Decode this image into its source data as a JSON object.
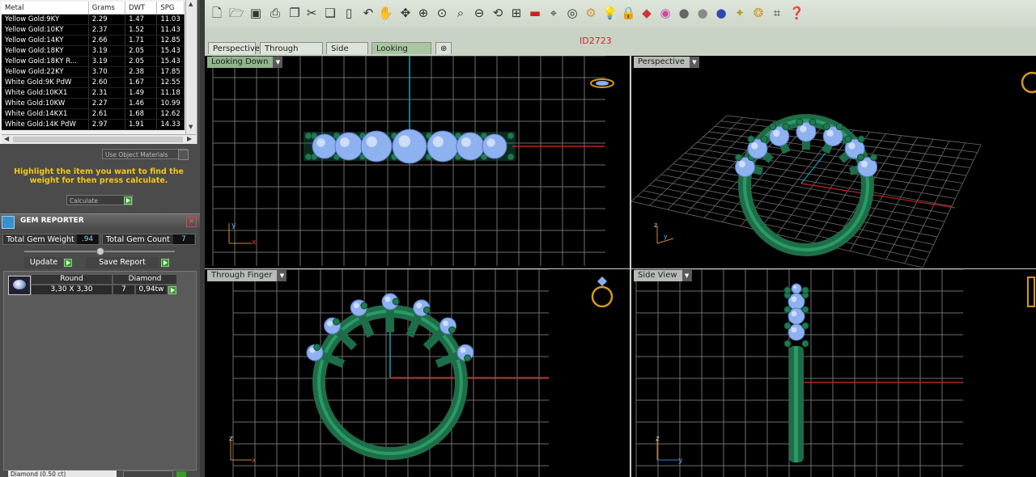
{
  "metal_table": {
    "headers": [
      "Metal",
      "Grams",
      "DWT",
      "SPG"
    ],
    "rows": [
      [
        "Yellow Gold:9KY",
        "2.29",
        "1.47",
        "11.03"
      ],
      [
        "Yellow Gold:10KY",
        "2.37",
        "1.52",
        "11.43"
      ],
      [
        "Yellow Gold:14KY",
        "2.66",
        "1.71",
        "12.85"
      ],
      [
        "Yellow Gold:18KY",
        "3.19",
        "2.05",
        "15.43"
      ],
      [
        "Yellow Gold:18KY R...",
        "3.19",
        "2.05",
        "15.43"
      ],
      [
        "Yellow Gold:22KY",
        "3.70",
        "2.38",
        "17.85"
      ],
      [
        "White Gold:9K PdW",
        "2.60",
        "1.67",
        "12.55"
      ],
      [
        "White Gold:10KX1",
        "2.31",
        "1.49",
        "11.18"
      ],
      [
        "White Gold:10KW",
        "2.27",
        "1.46",
        "10.99"
      ],
      [
        "White Gold:14KX1",
        "2.61",
        "1.68",
        "12.62"
      ],
      [
        "White Gold:14K PdW",
        "2.97",
        "1.91",
        "14.33"
      ]
    ]
  },
  "use_object_materials": "Use Object Materials",
  "instruction": "Highlight the item you want to find the weight for then press calculate.",
  "calculate_label": "Calculate",
  "gem_reporter": {
    "title": "GEM REPORTER",
    "total_weight_label": "Total Gem Weight",
    "total_weight_value": ".94",
    "total_count_label": "Total Gem Count",
    "total_count_value": "7",
    "update_label": "Update",
    "save_report_label": "Save Report",
    "gem_row": {
      "shape_header": "Round",
      "type_header": "Diamond",
      "size": "3,30 X 3,30",
      "count": "7",
      "weight": "0,94tw"
    }
  },
  "bottom_select": "Diamond (0.50 ct)",
  "id_label": "ID2723",
  "tabs": [
    "Perspective",
    "Through Finger",
    "Side View",
    "Looking Down"
  ],
  "active_tab": "Looking Down",
  "viewports": {
    "top_left": "Looking Down",
    "top_right": "Perspective",
    "bottom_left": "Through Finger",
    "bottom_right": "Side View"
  },
  "axis_labels": {
    "x": "x",
    "y": "y",
    "z": "z"
  },
  "colors": {
    "ring_green": "#1f7a52",
    "gem_blue": "#8eb1f0",
    "grid": "#7a7a7a",
    "axis_red": "#cc2020",
    "axis_cyan": "#20a0b0"
  }
}
